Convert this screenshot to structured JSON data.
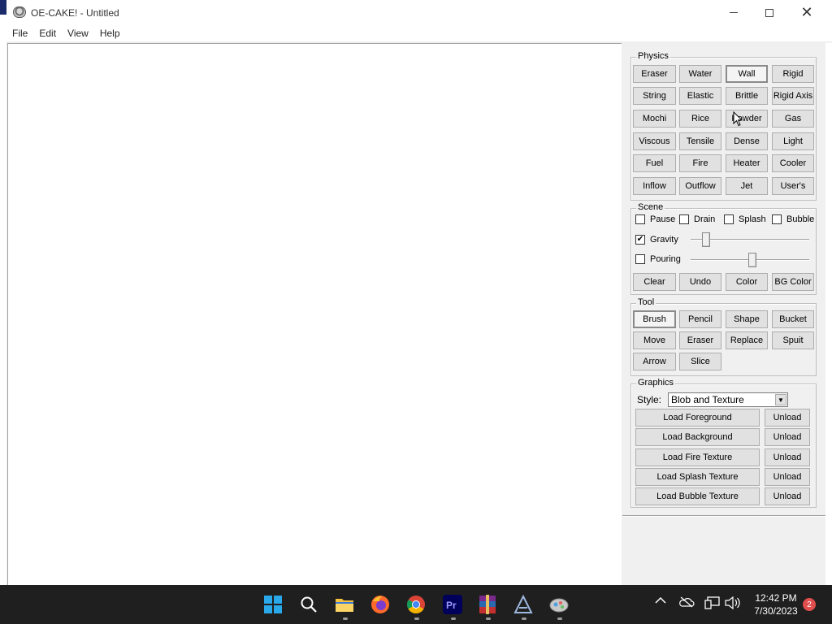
{
  "window": {
    "title": "OE-CAKE! - Untitled"
  },
  "menu": [
    "File",
    "Edit",
    "View",
    "Help"
  ],
  "physics": {
    "label": "Physics",
    "buttons": [
      "Eraser",
      "Water",
      "Wall",
      "Rigid",
      "String",
      "Elastic",
      "Brittle",
      "Rigid Axis",
      "Mochi",
      "Rice",
      "Powder",
      "Gas",
      "Viscous",
      "Tensile",
      "Dense",
      "Light",
      "Fuel",
      "Fire",
      "Heater",
      "Cooler",
      "Inflow",
      "Outflow",
      "Jet",
      "User's"
    ],
    "selected": "Wall"
  },
  "scene": {
    "label": "Scene",
    "checks": [
      {
        "label": "Pause",
        "checked": false
      },
      {
        "label": "Drain",
        "checked": false
      },
      {
        "label": "Splash",
        "checked": false
      },
      {
        "label": "Bubble",
        "checked": false
      }
    ],
    "gravity": {
      "label": "Gravity",
      "checked": true,
      "level": 0.1
    },
    "pouring": {
      "label": "Pouring",
      "checked": false,
      "level": 0.52
    },
    "buttons": [
      "Clear",
      "Undo",
      "Color",
      "BG Color"
    ]
  },
  "tool": {
    "label": "Tool",
    "buttons": [
      "Brush",
      "Pencil",
      "Shape",
      "Bucket",
      "Move",
      "Eraser",
      "Replace",
      "Spuit",
      "Arrow",
      "Slice"
    ],
    "selected": "Brush"
  },
  "graphics": {
    "label": "Graphics",
    "style_label": "Style:",
    "style_value": "Blob and Texture",
    "loads": [
      {
        "load": "Load Foreground",
        "unload": "Unload"
      },
      {
        "load": "Load Background",
        "unload": "Unload"
      },
      {
        "load": "Load Fire Texture",
        "unload": "Unload"
      },
      {
        "load": "Load Splash Texture",
        "unload": "Unload"
      },
      {
        "load": "Load Bubble Texture",
        "unload": "Unload"
      }
    ]
  },
  "taskbar": {
    "time": "12:42 PM",
    "date": "7/30/2023",
    "notifications": "2",
    "icons": [
      "windows-start-icon",
      "search-icon",
      "file-explorer-icon",
      "firefox-icon",
      "chrome-icon",
      "premiere-pro-icon",
      "winrar-icon",
      "app-a-icon",
      "oe-cake-icon"
    ]
  }
}
